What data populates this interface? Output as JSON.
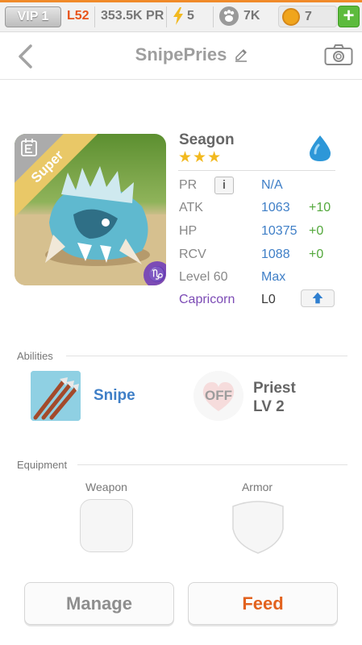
{
  "topbar": {
    "vip": "VIP 1",
    "level": "L52",
    "power": "353.5K PR",
    "energy": "5",
    "food": "7K",
    "gems": "7",
    "add": "+"
  },
  "header": {
    "title": "SnipePries"
  },
  "monster": {
    "name": "Seagon",
    "stars": "★★★",
    "rarity": "Super",
    "zodiac_symbol": "♑",
    "stats": [
      {
        "label": "PR",
        "value": "N/A",
        "bonus": ""
      },
      {
        "label": "ATK",
        "value": "1063",
        "bonus": "+10"
      },
      {
        "label": "HP",
        "value": "10375",
        "bonus": "+0"
      },
      {
        "label": "RCV",
        "value": "1088",
        "bonus": "+0"
      },
      {
        "label": "Level 60",
        "value": "Max",
        "bonus": ""
      },
      {
        "label": "Capricorn",
        "value": "L0",
        "bonus": ""
      }
    ],
    "info": "i"
  },
  "abilities": {
    "label": "Abilities",
    "primary": "Snipe",
    "secondary_state": "OFF",
    "secondary_name": "Priest",
    "secondary_level": "LV 2"
  },
  "equipment": {
    "label": "Equipment",
    "weapon": "Weapon",
    "armor": "Armor"
  },
  "actions": {
    "manage": "Manage",
    "feed": "Feed"
  },
  "colors": {
    "accent_orange": "#e2621e",
    "value_blue": "#3f7fc7",
    "bonus_green": "#53a83c",
    "zodiac_purple": "#7c4bb5"
  }
}
